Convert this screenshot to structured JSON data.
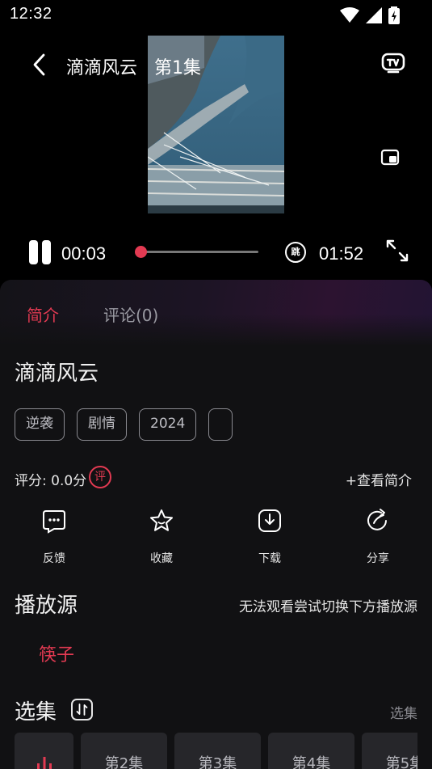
{
  "status_bar": {
    "time": "12:32"
  },
  "player": {
    "title": "滴滴风云",
    "episode": "第1集",
    "current_time": "00:03",
    "total_time": "01:52",
    "progress": 0.027,
    "skip_label": "跳"
  },
  "tabs": [
    {
      "label": "简介",
      "active": true
    },
    {
      "label": "评论(0)",
      "active": false
    }
  ],
  "details": {
    "title": "滴滴风云",
    "tags": [
      "逆袭",
      "剧情",
      "2024",
      ""
    ],
    "rating": "评分: 0.0分",
    "review_badge": "评",
    "more_intro": "+查看简介"
  },
  "actions": [
    {
      "label": "反馈",
      "icon": "feedback-icon"
    },
    {
      "label": "收藏",
      "icon": "star-icon"
    },
    {
      "label": "下载",
      "icon": "download-icon"
    },
    {
      "label": "分享",
      "icon": "share-icon"
    }
  ],
  "source": {
    "title": "播放源",
    "hint": "无法观看尝试切换下方播放源",
    "items": [
      "筷子"
    ]
  },
  "episodes": {
    "title": "选集",
    "more": "选集",
    "items": [
      "第2集",
      "第3集",
      "第4集",
      "第5集"
    ]
  },
  "colors": {
    "accent": "#e23a52",
    "background": "#111113"
  }
}
